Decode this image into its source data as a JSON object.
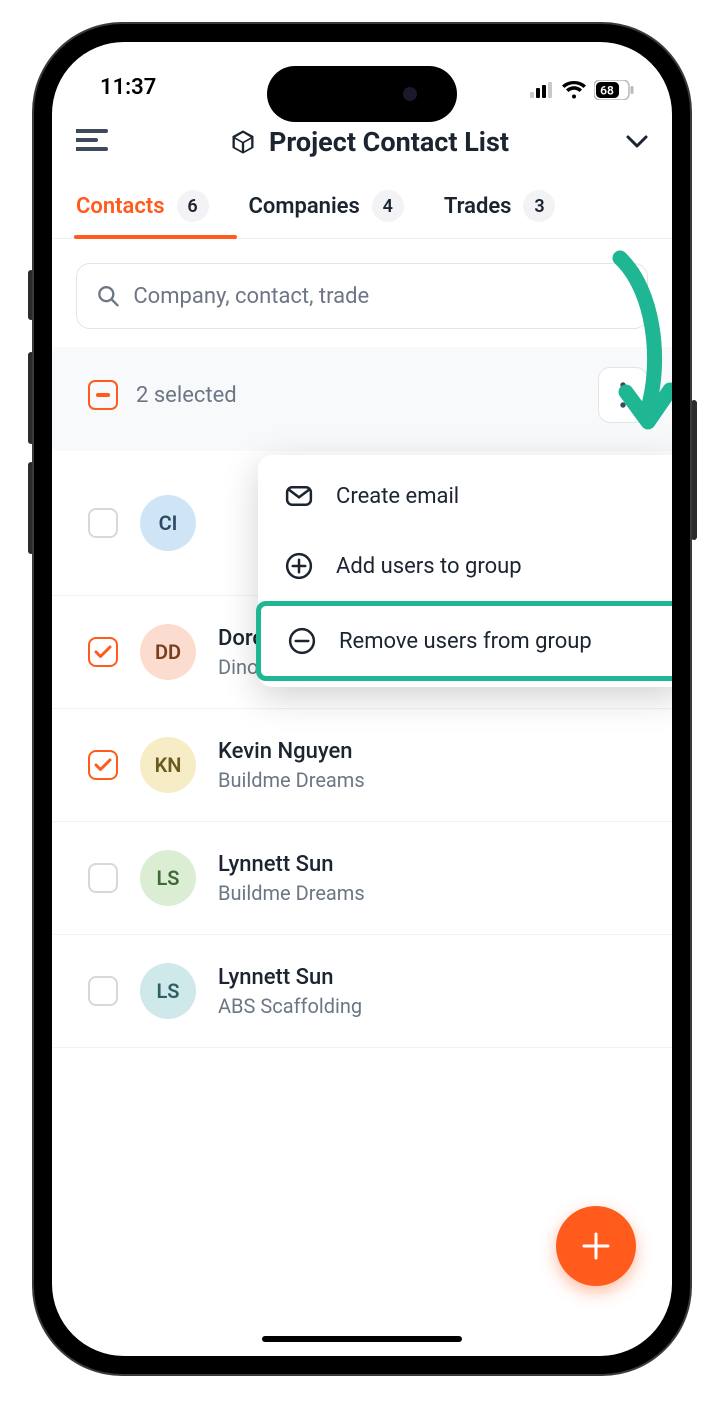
{
  "status": {
    "time": "11:37",
    "battery": "68"
  },
  "header": {
    "title": "Project Contact List"
  },
  "tabs": [
    {
      "label": "Contacts",
      "count": "6",
      "active": true
    },
    {
      "label": "Companies",
      "count": "4",
      "active": false
    },
    {
      "label": "Trades",
      "count": "3",
      "active": false
    }
  ],
  "search": {
    "placeholder": "Company, contact, trade"
  },
  "selection": {
    "label": "2 selected"
  },
  "menu": [
    {
      "icon": "mail",
      "label": "Create email"
    },
    {
      "icon": "plus-circle",
      "label": "Add users to group"
    },
    {
      "icon": "minus-circle",
      "label": "Remove users from group",
      "highlight": true
    }
  ],
  "contacts": [
    {
      "initials": "CI",
      "name": "",
      "company": "",
      "checked": false,
      "avatar_bg": "#cfe5f6",
      "avatar_fg": "#2b4a63",
      "group_header": true
    },
    {
      "initials": "DD",
      "name": "Dorothy Dino",
      "company": "Dino Cafe",
      "checked": true,
      "avatar_bg": "#fcdccf",
      "avatar_fg": "#7a3d20"
    },
    {
      "initials": "KN",
      "name": "Kevin Nguyen",
      "company": "Buildme Dreams",
      "checked": true,
      "avatar_bg": "#f6ecc5",
      "avatar_fg": "#6a5a1f"
    },
    {
      "initials": "LS",
      "name": "Lynnett Sun",
      "company": "Buildme Dreams",
      "checked": false,
      "avatar_bg": "#dbeed4",
      "avatar_fg": "#3f6a35"
    },
    {
      "initials": "LS",
      "name": "Lynnett Sun",
      "company": "ABS Scaffolding",
      "checked": false,
      "avatar_bg": "#cfe9ea",
      "avatar_fg": "#2d5f63"
    }
  ]
}
